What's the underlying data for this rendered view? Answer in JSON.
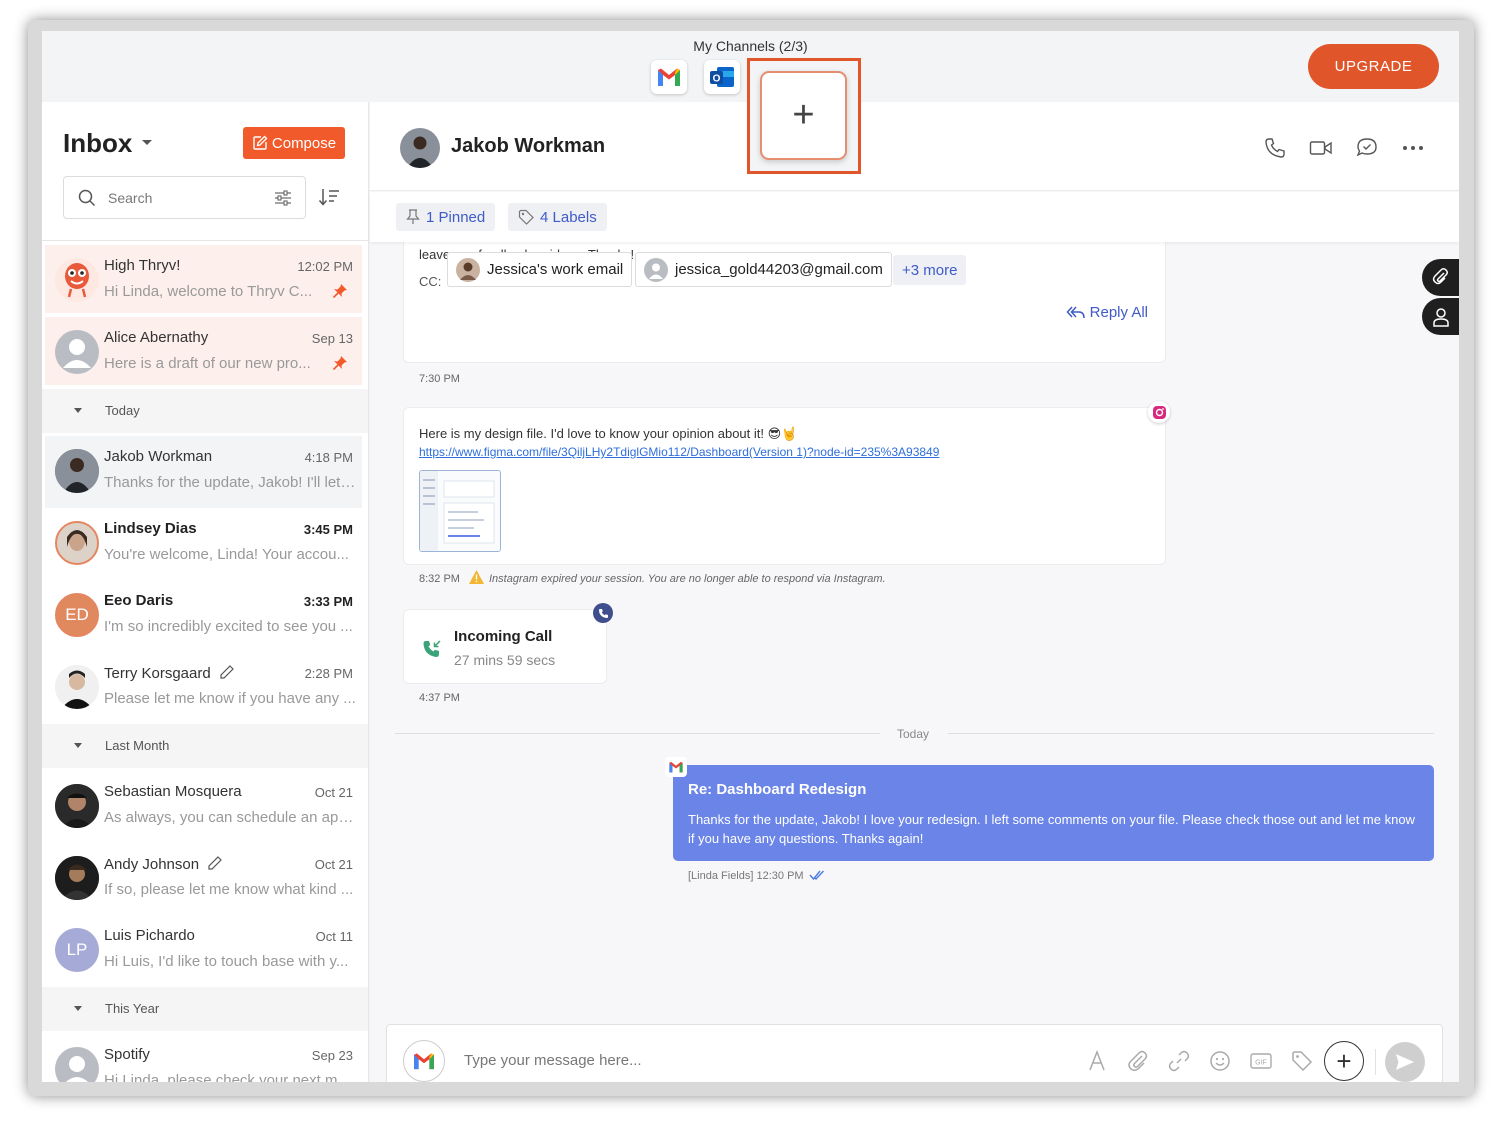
{
  "topbar": {
    "channels_title": "My Channels (2/3)",
    "channels": [
      {
        "icon": "gmail-icon"
      },
      {
        "icon": "outlook-icon"
      }
    ],
    "add_channel_symbol": "+",
    "upgrade_label": "UPGRADE"
  },
  "sidebar": {
    "title": "Inbox",
    "compose_label": "Compose",
    "search_placeholder": "Search",
    "conversations_top": [
      {
        "name": "High Thryv!",
        "time": "12:02 PM",
        "preview": "Hi Linda, welcome to Thryv C...",
        "pinned": true
      },
      {
        "name": "Alice Abernathy",
        "time": "Sep 13",
        "preview": "Here is a draft of our new pro...",
        "pinned": true
      }
    ],
    "groups": {
      "today": "Today",
      "last_month": "Last Month",
      "this_year": "This Year"
    },
    "today_items": [
      {
        "name": "Jakob Workman",
        "time": "4:18 PM",
        "preview": "Thanks for the update, Jakob! I'll let ..."
      },
      {
        "name": "Lindsey Dias",
        "time": "3:45 PM",
        "preview": "You're welcome, Linda! Your accou..."
      },
      {
        "name": "Eeo Daris",
        "initials": "ED",
        "time": "3:33 PM",
        "preview": "I'm so incredibly excited to see you ..."
      },
      {
        "name": "Terry Korsgaard",
        "time": "2:28 PM",
        "preview": "Please let me know if you have any ..."
      }
    ],
    "last_month_items": [
      {
        "name": "Sebastian Mosquera",
        "time": "Oct 21",
        "preview": "As always, you can schedule an app..."
      },
      {
        "name": "Andy Johnson",
        "time": "Oct 21",
        "preview": "If so, please let me know what kind ..."
      },
      {
        "name": "Luis Pichardo",
        "initials": "LP",
        "time": "Oct 11",
        "preview": "Hi Luis, I'd like to touch base with y..."
      }
    ],
    "this_year_items": [
      {
        "name": "Spotify",
        "time": "Sep 23",
        "preview": "Hi Linda, please check your next m..."
      }
    ]
  },
  "conversation": {
    "contact_name": "Jakob Workman",
    "pinned_label": "1 Pinned",
    "labels_label": "4 Labels",
    "email_tail": "leave any feedback or ideas. Thanks!",
    "cc_label": "CC:",
    "cc_chip_1": "Jessica's work email",
    "cc_chip_2": "jessica_gold44203@gmail.com",
    "cc_more": "+3 more",
    "reply_all": "Reply All",
    "time_1": "7:30 PM",
    "ig_message": "Here is my design file. I'd love to know your opinion about it! 😎🤘",
    "ig_link": "https://www.figma.com/file/3QiljLHy2TdiglGMio112/Dashboard(Version 1)?node-id=235%3A93849",
    "time_2": "8:32 PM",
    "ig_warning": "Instagram expired your session. You are no longer able to respond via Instagram.",
    "call_title": "Incoming Call",
    "call_duration": "27 mins 59 secs",
    "time_3": "4:37 PM",
    "divider_label": "Today",
    "out_subject": "Re: Dashboard Redesign",
    "out_body": "Thanks for the update, Jakob! I love your redesign. I left some comments on your file. Please check those out and let me know if you have any questions. Thanks again!",
    "out_meta": "[Linda Fields] 12:30 PM",
    "composer_placeholder": "Type your message here...",
    "composer_plus": "+"
  },
  "colors": {
    "brand_orange": "#e0562a",
    "accent_blue": "#3f5bc8",
    "bubble_blue": "#6a84e8"
  }
}
